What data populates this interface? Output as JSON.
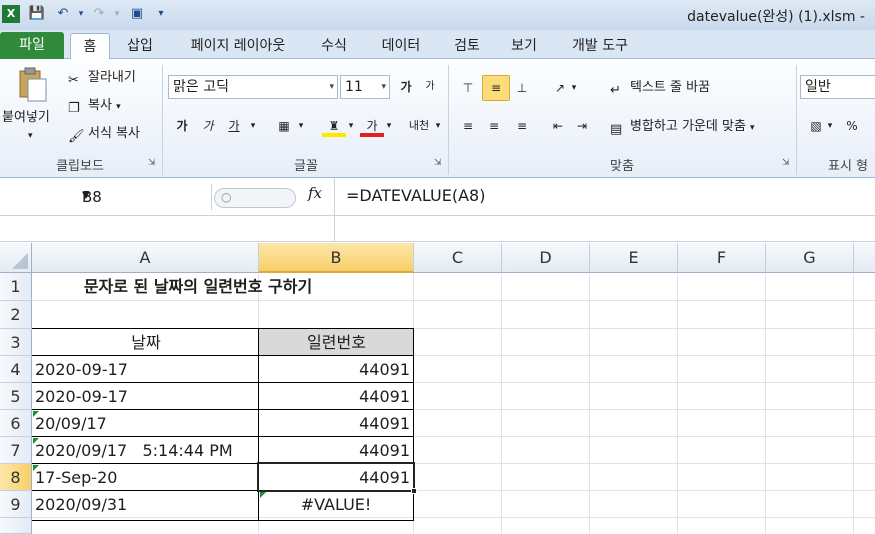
{
  "window": {
    "title": "datevalue(완성) (1).xlsm  -"
  },
  "quick_access": {
    "icons": [
      "excel-logo-icon",
      "save-icon",
      "undo-icon",
      "redo-icon",
      "camera-icon",
      "customize-icon"
    ]
  },
  "tabs": [
    {
      "label": "파일"
    },
    {
      "label": "홈"
    },
    {
      "label": "삽입"
    },
    {
      "label": "페이지 레이아웃"
    },
    {
      "label": "수식"
    },
    {
      "label": "데이터"
    },
    {
      "label": "검토"
    },
    {
      "label": "보기"
    },
    {
      "label": "개발 도구"
    }
  ],
  "ribbon": {
    "clipboard": {
      "paste": "붙여넣기",
      "cut": "잘라내기",
      "copy": "복사",
      "format_painter": "서식 복사",
      "label": "클립보드"
    },
    "font": {
      "name": "맑은 고딕",
      "size": "11",
      "grow": "가",
      "shrink": "가",
      "bold": "가",
      "italic": "가",
      "underline": "가",
      "font_color": "가",
      "phonetic": "내천",
      "label": "글꼴"
    },
    "alignment": {
      "wrap_text": "텍스트 줄 바꿈",
      "merge_center": "병합하고 가운데 맞춤",
      "label": "맞춤"
    },
    "number": {
      "format": "일반",
      "percent": "%",
      "label": "표시 형"
    }
  },
  "formula_bar": {
    "name_box": "B8",
    "fx": "fx",
    "formula": "=DATEVALUE(A8)"
  },
  "columns": [
    "A",
    "B",
    "C",
    "D",
    "E",
    "F",
    "G"
  ],
  "selected_column": "B",
  "rows": [
    "1",
    "2",
    "3",
    "4",
    "5",
    "6",
    "7",
    "8",
    "9"
  ],
  "selected_row": "8",
  "sheet": {
    "title": "문자로 된 날짜의 일련번호 구하기",
    "header_date": "날짜",
    "header_serial": "일련번호",
    "records": [
      {
        "date": "2020-09-17",
        "serial": "44091"
      },
      {
        "date": "2020-09-17",
        "serial": "44091"
      },
      {
        "date": "20/09/17",
        "serial": "44091"
      },
      {
        "date": "2020/09/17   5:14:44 PM",
        "serial": "44091"
      },
      {
        "date": "17-Sep-20",
        "serial": "44091"
      },
      {
        "date": "2020/09/31",
        "serial": "#VALUE!"
      }
    ]
  },
  "colors": {
    "file_tab": "#2f8a3a",
    "selection_header": "#f8cf6a",
    "error_indicator": "#1f8c3a"
  }
}
